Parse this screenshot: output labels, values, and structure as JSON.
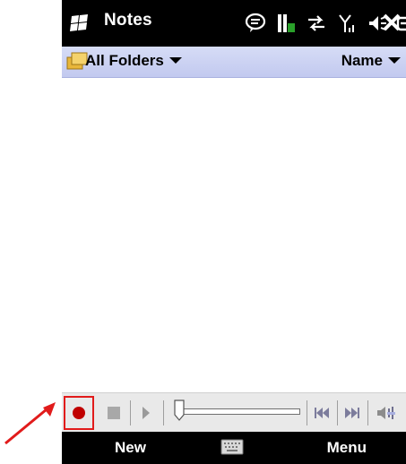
{
  "titlebar": {
    "title": "Notes",
    "status_icons": [
      "chat-bubble-icon",
      "battery-icon",
      "sync-arrows-icon",
      "signal-icon",
      "volume-icon",
      "keyboard-input-icon"
    ],
    "close_icon": "close-icon"
  },
  "folderbar": {
    "folder_label": "All Folders",
    "sort_label": "Name"
  },
  "recording_toolbar": {
    "buttons": [
      "record",
      "stop",
      "play",
      "previous",
      "next",
      "volume"
    ],
    "slider_position": 0.0
  },
  "softkeys": {
    "left": "New",
    "right": "Menu"
  },
  "colors": {
    "titlebar": "#000000",
    "folderbar": "#c8cef1",
    "highlight": "#e11b1b",
    "record": "#c00000"
  }
}
